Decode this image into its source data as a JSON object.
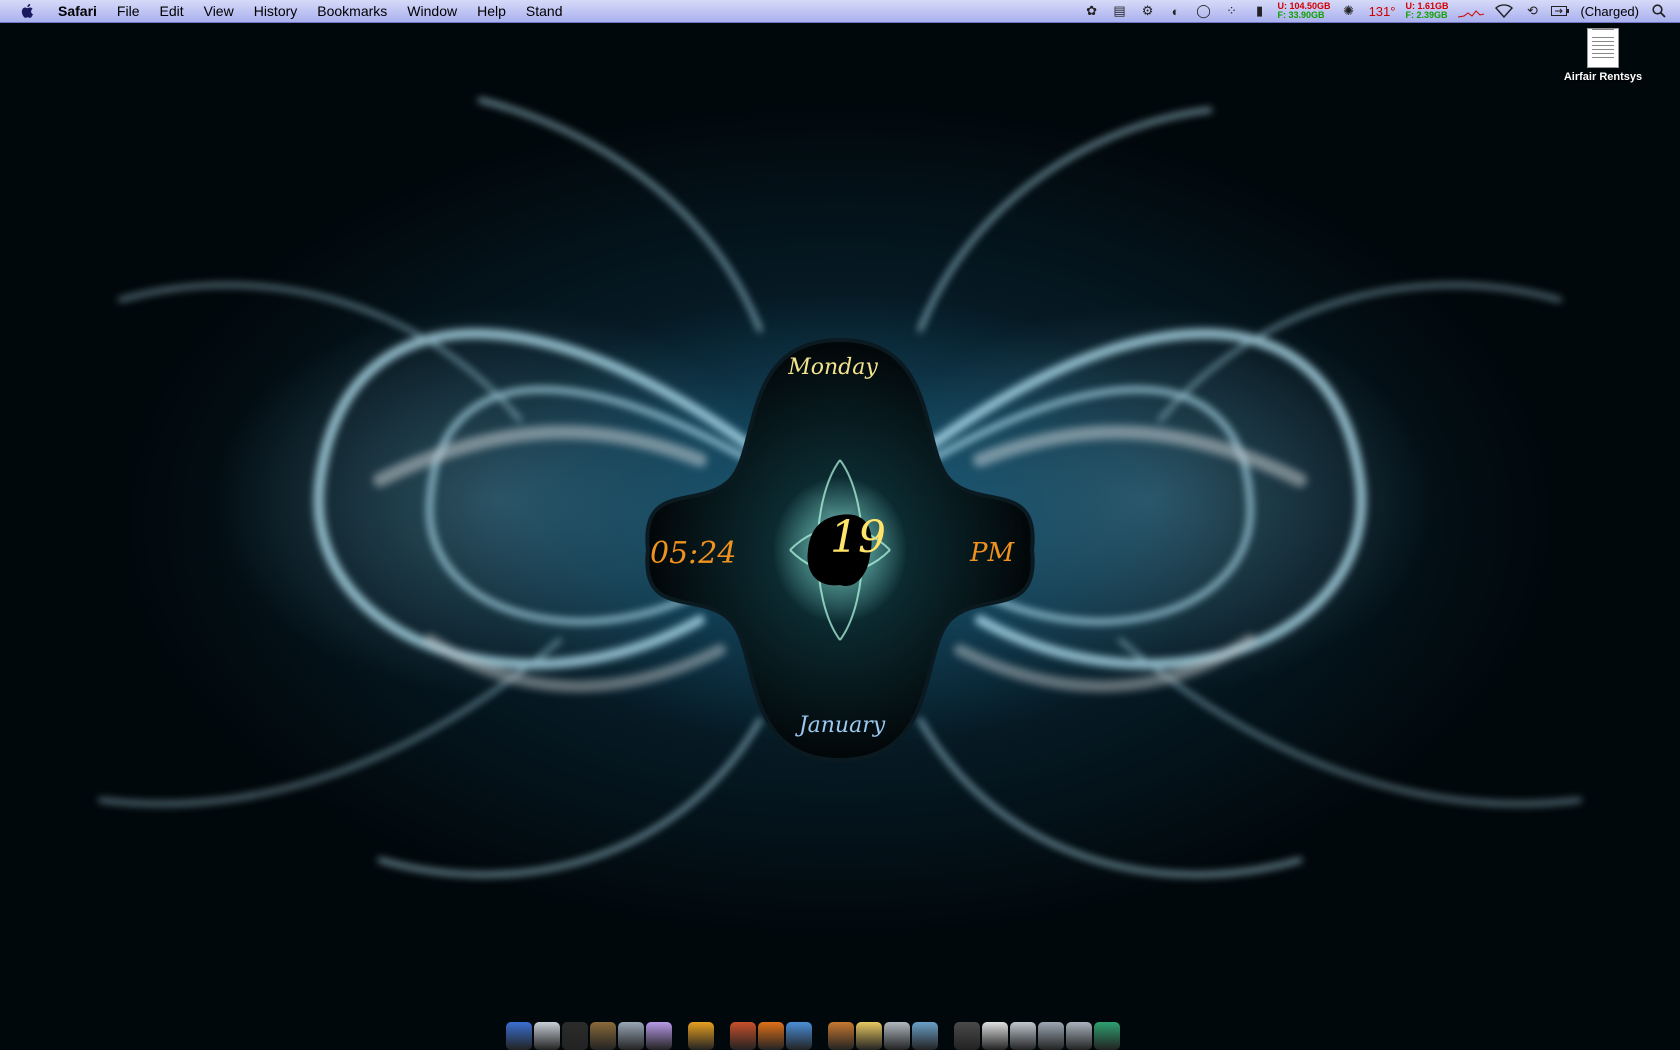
{
  "menubar": {
    "app_name": "Safari",
    "menus": [
      "File",
      "Edit",
      "View",
      "History",
      "Bookmarks",
      "Window",
      "Help",
      "Stand"
    ],
    "status": {
      "disk_used": "U: 104.50GB",
      "disk_free": "F: 33.90GB",
      "temperature": "131°",
      "mem_used": "U: 1.61GB",
      "mem_free": "F: 2.39GB",
      "battery": "(Charged)"
    }
  },
  "desktop": {
    "file_label": "Airfair Rentsys"
  },
  "clock": {
    "day": "Monday",
    "time": "05:24",
    "date": "19",
    "ampm": "PM",
    "month": "January"
  },
  "dock": {
    "item_colors": [
      "#3a6fd1",
      "#c9cfd8",
      "#2b2b2b",
      "#8a6a3a",
      "#9aa7b8",
      "#b89ae8",
      "#e8a020",
      "#c8502a",
      "#e07018",
      "#4a8fd8",
      "#c87830",
      "#e8c860",
      "#b0b8c0",
      "#6aa0c8",
      "#4a4a4a",
      "#e0e0e0",
      "#c0c8d0",
      "#9ca8b4",
      "#aab4be",
      "#2ea070"
    ]
  },
  "colors": {
    "menubar_top": "#d6daf8",
    "menubar_bottom": "#aab1ee",
    "clock_orange": "#f0921e",
    "clock_yellow": "#f4e38c",
    "clock_blue": "#9cc8f0"
  }
}
